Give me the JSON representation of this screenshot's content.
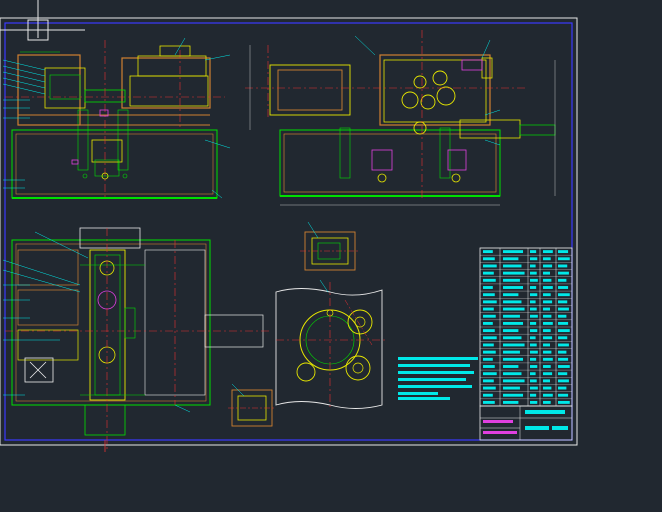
{
  "canvas": {
    "background": "#212830",
    "border_color": "#e8e8e8",
    "frame_color": "#3a3aff",
    "colors": {
      "outline": "#00e000",
      "yellow": "#e8e800",
      "cyan": "#00e8e8",
      "center_line": "#e83030",
      "hatch": "#d08030",
      "dim": "#c0c0c0",
      "magenta": "#e040e0",
      "white": "#f0f0f0"
    }
  },
  "cursor": {
    "icon": "crosshair-icon"
  },
  "views": {
    "front_section": "front-section-view",
    "side_section": "side-section-view",
    "plan_section": "plan-section-view",
    "detail_a": "detail-view-a",
    "detail_b": "detail-view-b",
    "flange_view": "flange-view"
  },
  "title_block": {
    "parts_table_rows": 22,
    "notes_lines": 7
  }
}
